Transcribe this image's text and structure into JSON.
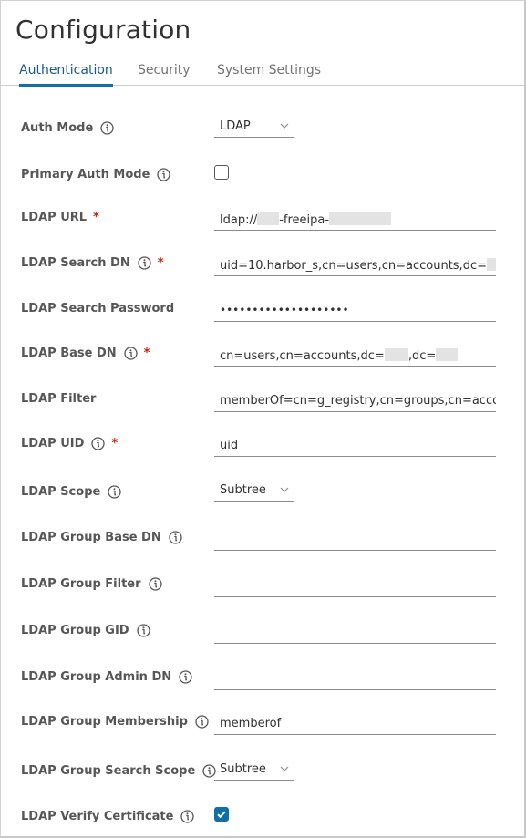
{
  "page": {
    "title": "Configuration"
  },
  "tabs": [
    {
      "label": "Authentication",
      "active": true
    },
    {
      "label": "Security",
      "active": false
    },
    {
      "label": "System Settings",
      "active": false
    }
  ],
  "form": {
    "auth_mode": {
      "label": "Auth Mode",
      "value": "LDAP"
    },
    "primary_auth_mode": {
      "label": "Primary Auth Mode",
      "checked": false
    },
    "ldap_url": {
      "label": "LDAP URL",
      "required": "*",
      "value_prefix": "ldap://",
      "value_mid": "-freeipa-"
    },
    "ldap_search_dn": {
      "label": "LDAP Search DN",
      "required": "*",
      "value": "uid=10.harbor_s,cn=users,cn=accounts,dc="
    },
    "ldap_search_password": {
      "label": "LDAP Search Password",
      "value": "••••••••••••••••••••"
    },
    "ldap_base_dn": {
      "label": "LDAP Base DN",
      "required": "*",
      "value_prefix": "cn=users,cn=accounts,dc=",
      "value_mid": ",dc="
    },
    "ldap_filter": {
      "label": "LDAP Filter",
      "value": "memberOf=cn=g_registry,cn=groups,cn=accour"
    },
    "ldap_uid": {
      "label": "LDAP UID",
      "required": "*",
      "value": "uid"
    },
    "ldap_scope": {
      "label": "LDAP Scope",
      "value": "Subtree"
    },
    "ldap_group_base_dn": {
      "label": "LDAP Group Base DN",
      "value": ""
    },
    "ldap_group_filter": {
      "label": "LDAP Group Filter",
      "value": ""
    },
    "ldap_group_gid": {
      "label": "LDAP Group GID",
      "value": ""
    },
    "ldap_group_admin_dn": {
      "label": "LDAP Group Admin DN",
      "value": ""
    },
    "ldap_group_membership": {
      "label": "LDAP Group Membership",
      "value": "memberof"
    },
    "ldap_group_search_scope": {
      "label": "LDAP Group Search Scope",
      "value": "Subtree"
    },
    "ldap_verify_certificate": {
      "label": "LDAP Verify Certificate",
      "checked": true
    }
  },
  "colors": {
    "accent": "#0f6fa6",
    "required": "#c92100",
    "text": "#565656"
  },
  "icons": {
    "info": "info-icon",
    "chevron": "chevron-down-icon",
    "check": "check-icon"
  }
}
